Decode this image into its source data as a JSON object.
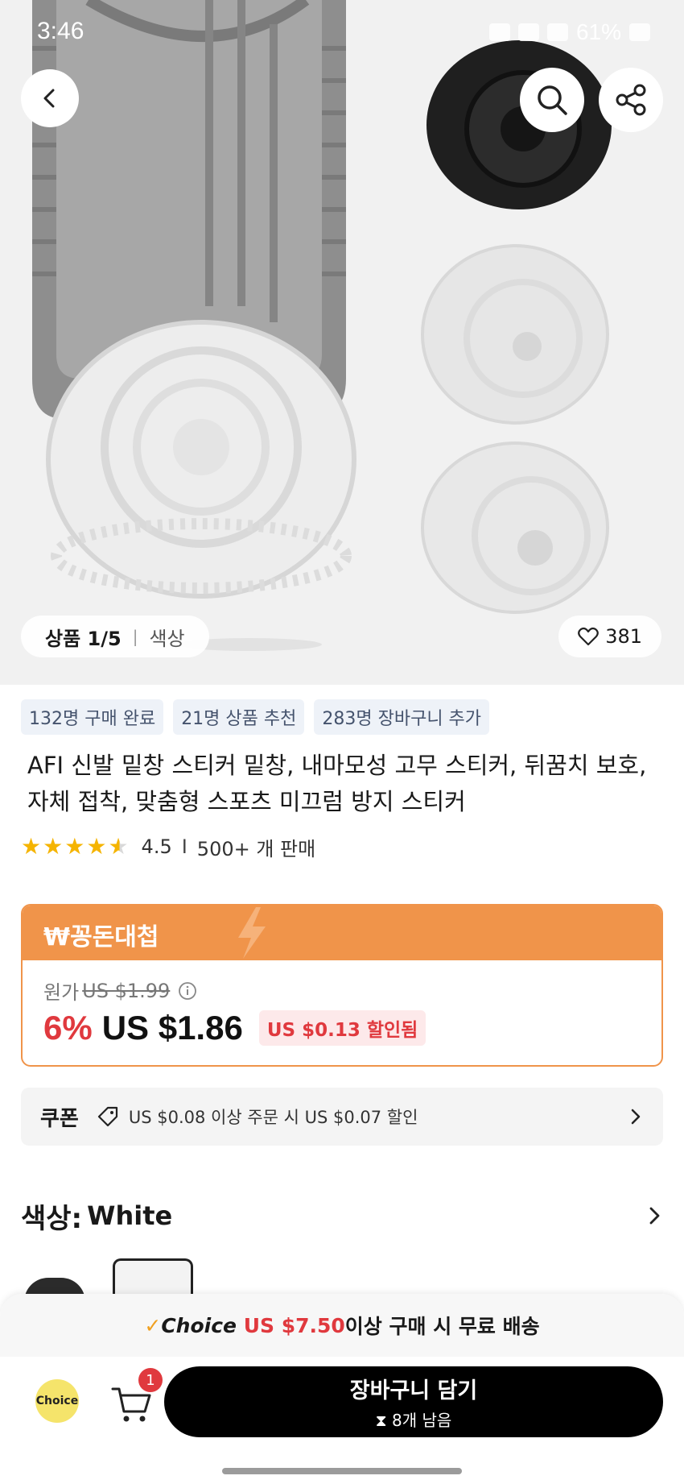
{
  "status_bar": {
    "time": "3:46",
    "battery": "61%"
  },
  "hero": {
    "counter": "상품 1/5",
    "separator": "|",
    "color_label": "색상",
    "likes": "381"
  },
  "tags": [
    "132명 구매 완료",
    "21명 상품 추천",
    "283명 장바구니 추가"
  ],
  "product": {
    "title": "AFI 신발 밑창 스티커 밑창, 내마모성 고무 스티커, 뒤꿈치 보호, 자체 접착, 맞춤형 스포츠 미끄럼 방지 스티커",
    "rating": "4.5",
    "rating_sep": "I",
    "sold": "500+ 개 판매"
  },
  "deal": {
    "label": "₩꽁돈대첩",
    "original_label": "원가",
    "original_price": "US $1.99",
    "discount": "6%",
    "price": "US $1.86",
    "saved": "US $0.13 할인됨"
  },
  "coupon": {
    "label": "쿠폰",
    "text": "US $0.08 이상 주문 시 US $0.07 할인"
  },
  "color": {
    "key": "색상:",
    "value": "White"
  },
  "bottom": {
    "ship_check": "✓",
    "ship_choice": "Choice",
    "ship_amount": "US $7.50",
    "ship_text": "이상 구매 시 무료 배송",
    "choice_badge": "Choice",
    "cart_count": "1",
    "add_to_cart": "장바구니 담기",
    "stock": "8개 남음"
  },
  "colors": {
    "accent_orange": "#f0944a",
    "price_red": "#e0393e",
    "tag_bg": "#eef2f8",
    "star": "#f5b400"
  }
}
